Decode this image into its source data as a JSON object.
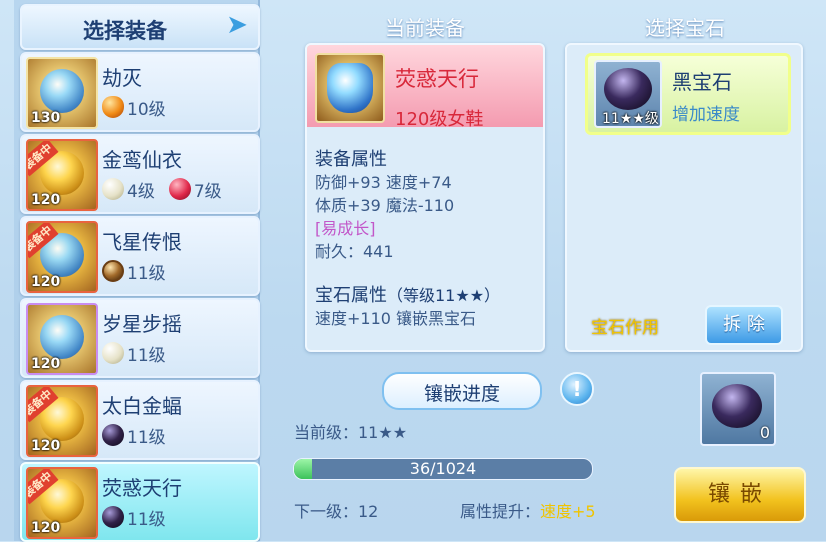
{
  "left": {
    "title": "选择装备",
    "items": [
      {
        "name": "劫灭",
        "level": "130",
        "equipped": false,
        "gems": [
          {
            "type": "orange",
            "label": "10级"
          }
        ]
      },
      {
        "name": "金鸾仙衣",
        "level": "120",
        "equipped": true,
        "badge": "装备中",
        "gems": [
          {
            "type": "pearl",
            "label": "4级"
          },
          {
            "type": "ruby",
            "label": "7级"
          }
        ]
      },
      {
        "name": "飞星传恨",
        "level": "120",
        "equipped": true,
        "badge": "装备中",
        "gems": [
          {
            "type": "bronze",
            "label": "11级"
          }
        ]
      },
      {
        "name": "岁星步摇",
        "level": "120",
        "equipped": false,
        "gems": [
          {
            "type": "pearl",
            "label": "11级"
          }
        ]
      },
      {
        "name": "太白金蝠",
        "level": "120",
        "equipped": true,
        "badge": "装备中",
        "gems": [
          {
            "type": "black",
            "label": "11级"
          }
        ]
      },
      {
        "name": "荧惑天行",
        "level": "120",
        "equipped": true,
        "badge": "装备中",
        "gems": [
          {
            "type": "black",
            "label": "11级"
          }
        ]
      }
    ]
  },
  "middle": {
    "title": "当前装备",
    "equip_name": "荧惑天行",
    "equip_sub": "120级女鞋",
    "attr_title": "装备属性",
    "attr_line1": "防御+93 速度+74",
    "attr_line2": "体质+39 魔法-110",
    "special": "[易成长]",
    "durability": "耐久：441",
    "gem_attr_title": "宝石属性",
    "gem_attr_level": "（等级11★★）",
    "gem_attr_line": "速度+110 镶嵌黑宝石"
  },
  "right": {
    "title": "选择宝石",
    "gem_name": "黑宝石",
    "gem_level": "11★★级",
    "gem_effect": "增加速度",
    "gem_use_label": "宝石作用",
    "remove_label": "拆 除"
  },
  "progress": {
    "title": "镶嵌进度",
    "help": "!",
    "current": "当前级：11★★",
    "value": 36,
    "max": 1024,
    "text": "36/1024",
    "next": "下一级：12",
    "attr_label": "属性提升：",
    "attr_value": "速度+5"
  },
  "stock": {
    "count": "0"
  },
  "inlay_label": "镶嵌",
  "colors": {
    "accent_red": "#d8283a",
    "accent_yellow": "#f0c400",
    "title_blue": "#1e3f73"
  }
}
